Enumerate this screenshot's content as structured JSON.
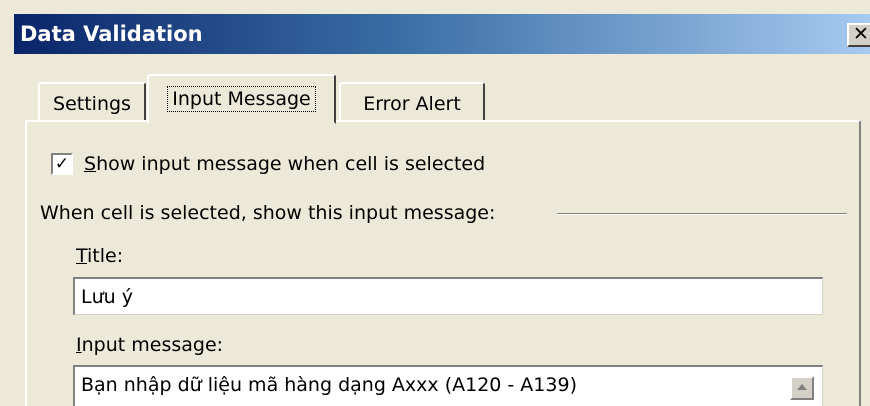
{
  "window": {
    "title": "Data Validation",
    "close_glyph": "✕"
  },
  "tabs": [
    {
      "label": "Settings",
      "active": false
    },
    {
      "label": "Input Message",
      "active": true
    },
    {
      "label": "Error Alert",
      "active": false
    }
  ],
  "show_message": {
    "checked": true,
    "check_glyph": "✓",
    "label_mnemonic": "S",
    "label_rest": "how input message when cell is selected"
  },
  "group_label": "When cell is selected, show this input message:",
  "title_field": {
    "label_mnemonic": "T",
    "label_rest": "itle:",
    "value": "Lưu ý"
  },
  "message_field": {
    "label_mnemonic": "I",
    "label_rest": "nput message:",
    "value": "Bạn nhập dữ liệu mã hàng dạng Axxx (A120 - A139)"
  },
  "icons": {
    "close": "close-icon",
    "checkmark": "checkmark-icon",
    "scroll_up": "scroll-up-arrow-icon"
  },
  "colors": {
    "titlebar_start": "#0a246a",
    "titlebar_end": "#a6caf0",
    "dialog_bg": "#ece9d8"
  }
}
